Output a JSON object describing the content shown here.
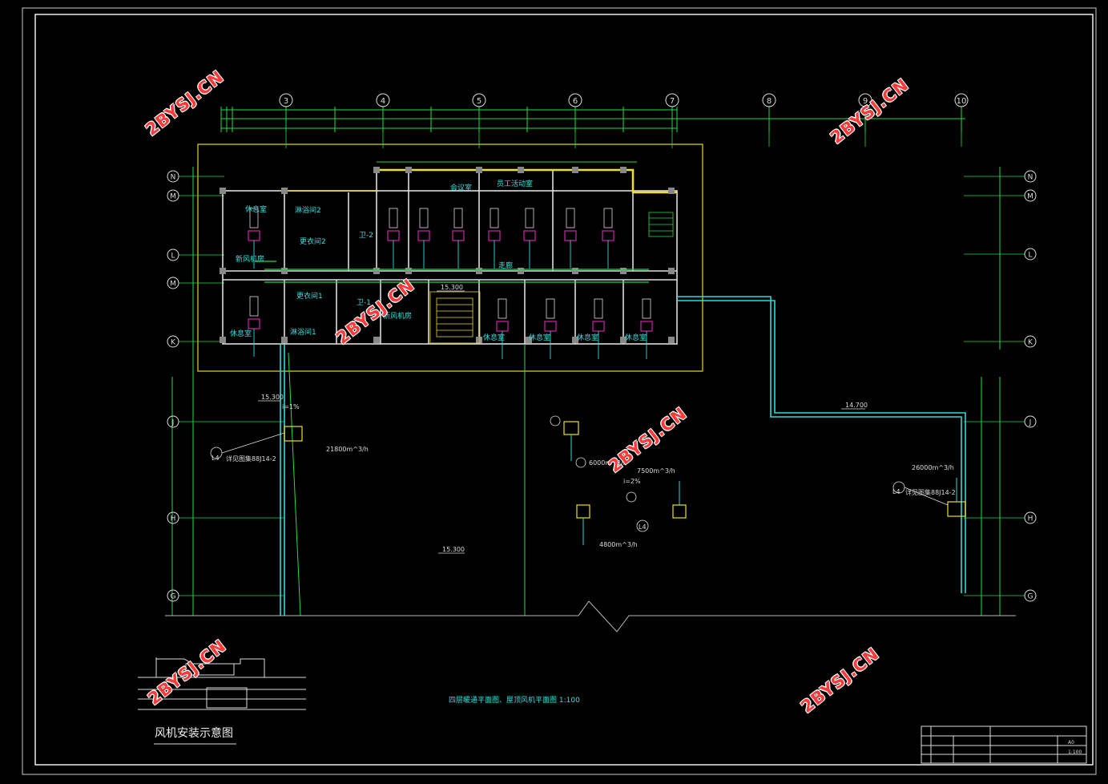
{
  "axis_columns": [
    "3",
    "4",
    "5",
    "6",
    "7",
    "8",
    "9",
    "10"
  ],
  "axis_rows_left": [
    "N",
    "M",
    "L",
    "M",
    "K",
    "J",
    "H",
    "G"
  ],
  "axis_rows_right": [
    "N",
    "M",
    "L",
    "K",
    "J",
    "H",
    "G"
  ],
  "rooms": {
    "resting_a": "休息室",
    "rest_1": "休息室",
    "locker_2": "更衣间2",
    "wash_2": "淋浴间2",
    "toilet_2": "卫-2",
    "new_fan_a": "新风机房",
    "new_fan_b": "新风机房",
    "locker_1": "更衣间1",
    "wash_1": "淋浴间1",
    "toilet_1": "卫-1",
    "meeting": "会议室",
    "staff_rest": "员工活动室",
    "corridor": "走廊",
    "rest_b": "休息室",
    "rest_c": "休息室",
    "rest_d": "休息室",
    "rest_e": "休息室",
    "rest_f": "休息室"
  },
  "elevations": {
    "floor": "15.300",
    "roof_left": "15.300",
    "roof_center": "15.300",
    "roof_right": "14.700"
  },
  "airflow": {
    "left": "21800m^3/h",
    "mid_1": "6000m^3/h",
    "mid_2": "7500m^3/h",
    "mid_3": "4800m^3/h",
    "right": "26000m^3/h",
    "slope_1": "i=1%",
    "slope_2": "i=2%"
  },
  "details": {
    "left_tag": "L4",
    "left_ref": "详见图集88J14-2",
    "right_tag": "L4",
    "right_ref": "详见图集88J14-2",
    "mid_tag": "L4"
  },
  "drawing_title": "四层暖通平面图、屋顶风机平面图  1:100",
  "install_title": "风机安装示意图",
  "title_block": {
    "scale": "1:100",
    "size_label": "A0"
  },
  "watermark": "2BYSJ.CN",
  "colors": {
    "background": "#000000",
    "frame": "#ffffff",
    "axis": "#22dd44",
    "room_text": "#33e0e0",
    "outline": "#f0e020",
    "duct": "#30d8d8",
    "fan": "#b02090",
    "watermark": "#ff3a3a"
  }
}
